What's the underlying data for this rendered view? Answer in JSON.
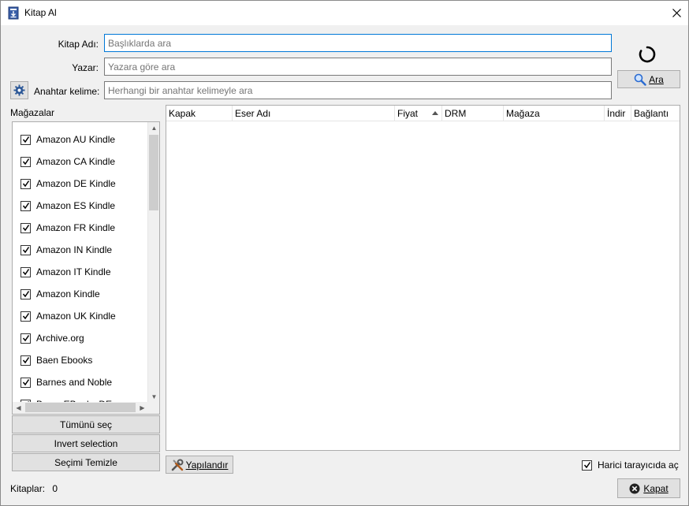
{
  "window": {
    "title": "Kitap Al"
  },
  "form": {
    "title_label": "Kitap Adı:",
    "title_placeholder": "Başlıklarda ara",
    "author_label": "Yazar:",
    "author_placeholder": "Yazara göre ara",
    "keyword_label": "Anahtar kelime:",
    "keyword_placeholder": "Herhangi bir anahtar kelimeyle ara",
    "search_button": "Ara"
  },
  "stores": {
    "label": "Mağazalar",
    "items": [
      {
        "name": "Amazon AU Kindle",
        "checked": true
      },
      {
        "name": "Amazon CA Kindle",
        "checked": true
      },
      {
        "name": "Amazon DE Kindle",
        "checked": true
      },
      {
        "name": "Amazon ES Kindle",
        "checked": true
      },
      {
        "name": "Amazon FR Kindle",
        "checked": true
      },
      {
        "name": "Amazon IN Kindle",
        "checked": true
      },
      {
        "name": "Amazon IT Kindle",
        "checked": true
      },
      {
        "name": "Amazon Kindle",
        "checked": true
      },
      {
        "name": "Amazon UK Kindle",
        "checked": true
      },
      {
        "name": "Archive.org",
        "checked": true
      },
      {
        "name": "Baen Ebooks",
        "checked": true
      },
      {
        "name": "Barnes and Noble",
        "checked": true
      },
      {
        "name": "Beam EBooks DE",
        "checked": true
      }
    ],
    "select_all": "Tümünü seç",
    "invert_selection": "Invert selection",
    "clear_selection": "Seçimi Temizle"
  },
  "results": {
    "columns": [
      "Kapak",
      "Eser Adı",
      "Fiyat",
      "DRM",
      "Mağaza",
      "İndir",
      "Bağlantı"
    ],
    "rows": []
  },
  "bottom": {
    "configure_button": "Yapılandır",
    "external_browser_label": "Harici tarayıcıda aç",
    "external_browser_checked": true,
    "books_label": "Kitaplar:",
    "books_count": "0",
    "close_button": "Kapat"
  },
  "icons": {
    "app": "book-download-icon",
    "close": "close-icon",
    "gear": "gear-icon",
    "search": "magnifier-icon",
    "configure": "tools-icon",
    "kapat": "close-circle-icon",
    "spinner": "spinner-icon"
  },
  "colors": {
    "focus": "#0078d7",
    "accent_blue": "#2b5797"
  }
}
